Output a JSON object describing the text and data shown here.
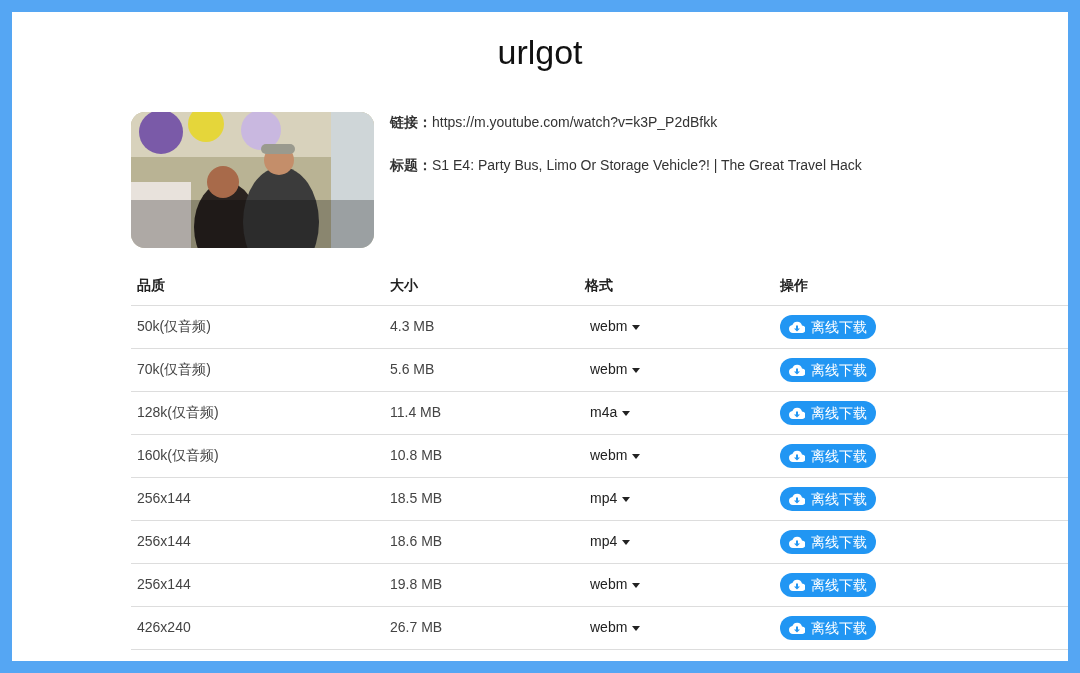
{
  "site_title": "urlgot",
  "video": {
    "link_label": "链接：",
    "link": "https://m.youtube.com/watch?v=k3P_P2dBfkk",
    "title_label": "标题：",
    "title": "S1 E4: Party Bus, Limo Or Storage Vehicle?! | The Great Travel Hack"
  },
  "table": {
    "columns": [
      "品质",
      "大小",
      "格式",
      "操作"
    ],
    "rows": [
      {
        "quality": "50k(仅音频)",
        "size": "4.3 MB",
        "format": "webm",
        "action": "离线下载"
      },
      {
        "quality": "70k(仅音频)",
        "size": "5.6 MB",
        "format": "webm",
        "action": "离线下载"
      },
      {
        "quality": "128k(仅音频)",
        "size": "11.4 MB",
        "format": "m4a",
        "action": "离线下载"
      },
      {
        "quality": "160k(仅音频)",
        "size": "10.8 MB",
        "format": "webm",
        "action": "离线下载"
      },
      {
        "quality": "256x144",
        "size": "18.5 MB",
        "format": "mp4",
        "action": "离线下载"
      },
      {
        "quality": "256x144",
        "size": "18.6 MB",
        "format": "mp4",
        "action": "离线下载"
      },
      {
        "quality": "256x144",
        "size": "19.8 MB",
        "format": "webm",
        "action": "离线下载"
      },
      {
        "quality": "426x240",
        "size": "26.7 MB",
        "format": "webm",
        "action": "离线下载"
      }
    ]
  }
}
